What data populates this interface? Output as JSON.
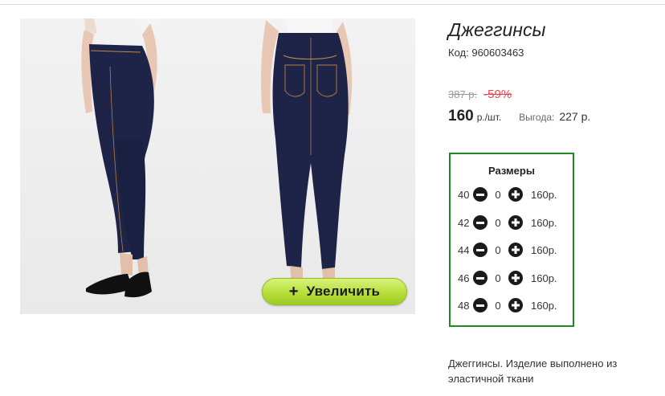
{
  "product": {
    "title": "Джеггинсы",
    "code_label": "Код:",
    "code_value": "960603463",
    "old_price": "387 р.",
    "discount": "-59%",
    "price": "160",
    "price_unit": "р./шт.",
    "benefit_label": "Выгода:",
    "benefit_value": "227 р.",
    "description": "Джеггинсы. Изделие выполнено из эластичной ткани"
  },
  "image": {
    "zoom_plus": "+",
    "zoom_label": "Увеличить"
  },
  "sizes": {
    "title": "Размеры",
    "rows": [
      {
        "size": "40",
        "qty": "0",
        "price": "160р."
      },
      {
        "size": "42",
        "qty": "0",
        "price": "160р."
      },
      {
        "size": "44",
        "qty": "0",
        "price": "160р."
      },
      {
        "size": "46",
        "qty": "0",
        "price": "160р."
      },
      {
        "size": "48",
        "qty": "0",
        "price": "160р."
      }
    ]
  },
  "colors": {
    "accent_green": "#1f8a1f",
    "zoom_button": "#b7df3a",
    "discount_red": "#e8474c"
  },
  "icons": {
    "minus": "minus-circle-icon",
    "plus": "plus-circle-icon"
  }
}
